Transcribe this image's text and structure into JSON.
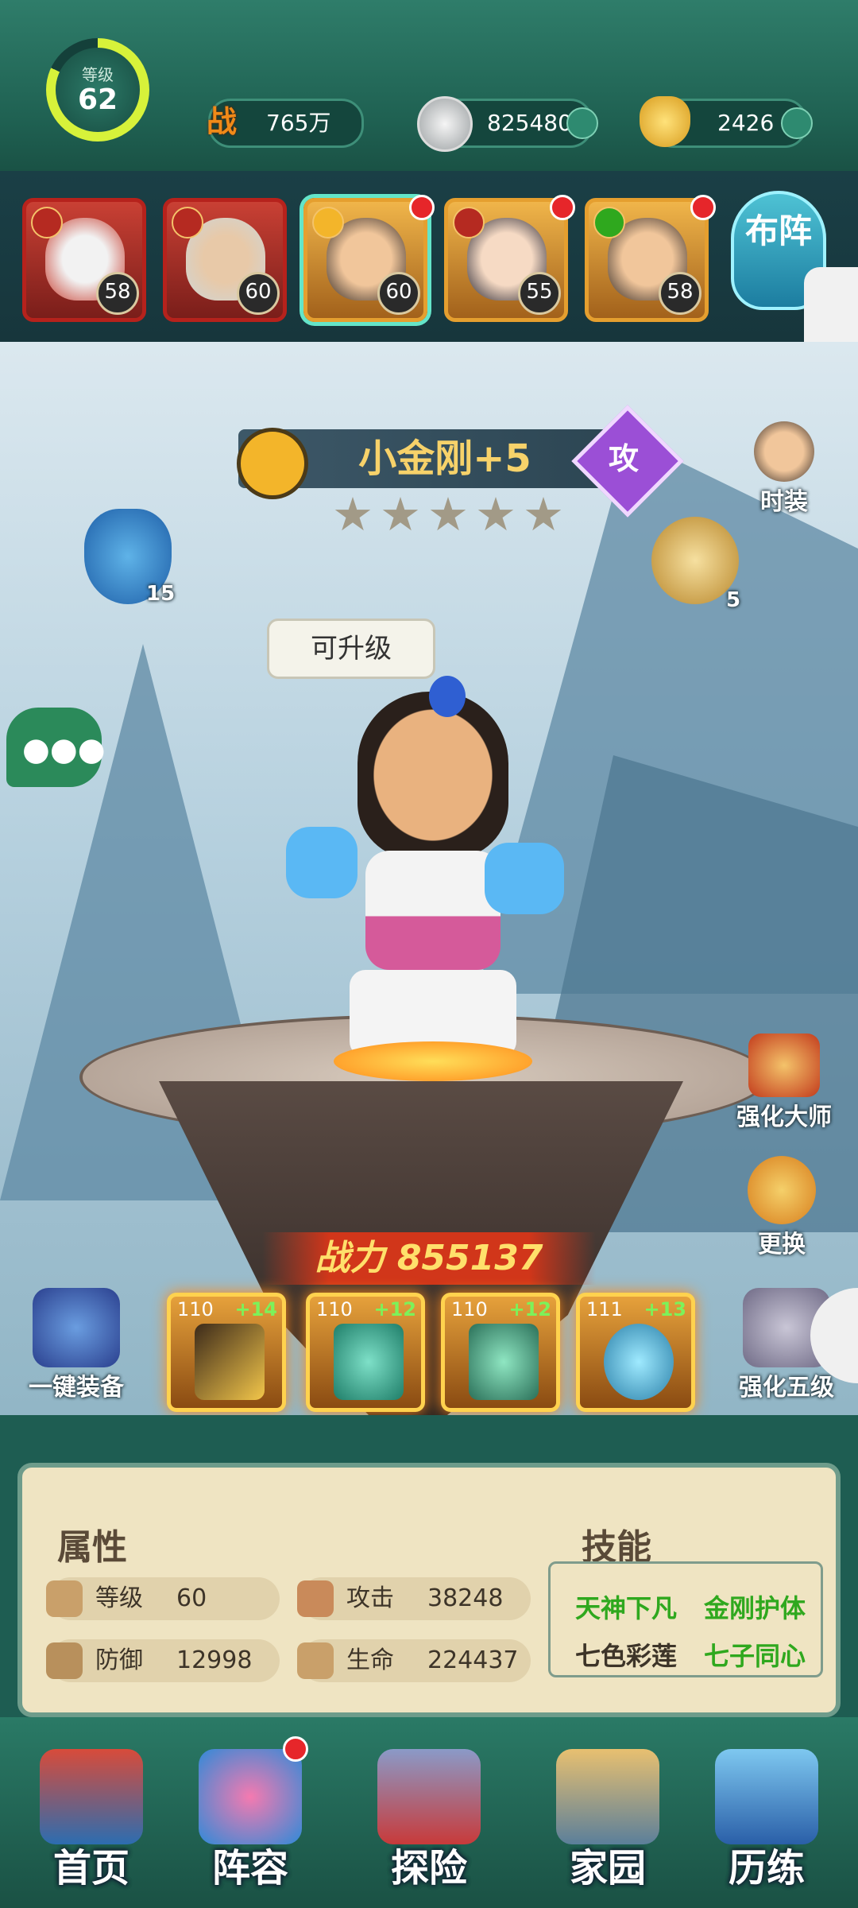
{
  "top_bar": {
    "level_label": "等级",
    "level": "62",
    "level_progress": 0.82,
    "power_label": "战",
    "power": "765万",
    "silver": "825480",
    "gold": "2426"
  },
  "heroes": [
    {
      "level": "58",
      "frame": "red",
      "selected": false,
      "alert": false
    },
    {
      "level": "60",
      "frame": "red",
      "selected": false,
      "alert": false
    },
    {
      "level": "60",
      "frame": "gold",
      "selected": true,
      "alert": true
    },
    {
      "level": "55",
      "frame": "gold",
      "selected": false,
      "alert": true
    },
    {
      "level": "58",
      "frame": "gold",
      "selected": false,
      "alert": true
    }
  ],
  "formation_label": "布阵",
  "character": {
    "name": "小金刚+5",
    "class_char": "攻",
    "stars": 5,
    "bubble": "可升级"
  },
  "side_buttons": {
    "costume": "时装",
    "left_item_count": "15",
    "right_item_count": "5",
    "master": "强化大师",
    "replace": "更换",
    "one_click": "一键装备",
    "enhance5": "强化五级"
  },
  "power": {
    "label": "战力",
    "value": "855137"
  },
  "equipment": [
    {
      "level": "110",
      "plus": "+14",
      "icon": "axe-icon"
    },
    {
      "level": "110",
      "plus": "+12",
      "icon": "armor-icon"
    },
    {
      "level": "110",
      "plus": "+12",
      "icon": "helmet-icon"
    },
    {
      "level": "111",
      "plus": "+13",
      "icon": "necklace-icon"
    }
  ],
  "attributes": {
    "title": "属性",
    "level_label": "等级",
    "level": "60",
    "attack_label": "攻击",
    "attack": "38248",
    "defense_label": "防御",
    "defense": "12998",
    "hp_label": "生命",
    "hp": "224437"
  },
  "skills": {
    "title": "技能",
    "items": [
      "天神下凡",
      "金刚护体",
      "七色彩莲",
      "七子同心"
    ]
  },
  "nav": [
    "首页",
    "阵容",
    "探险",
    "家园",
    "历练"
  ],
  "colors": {
    "skill_active": "#2fa81e",
    "skill_inactive": "#3d3428"
  }
}
